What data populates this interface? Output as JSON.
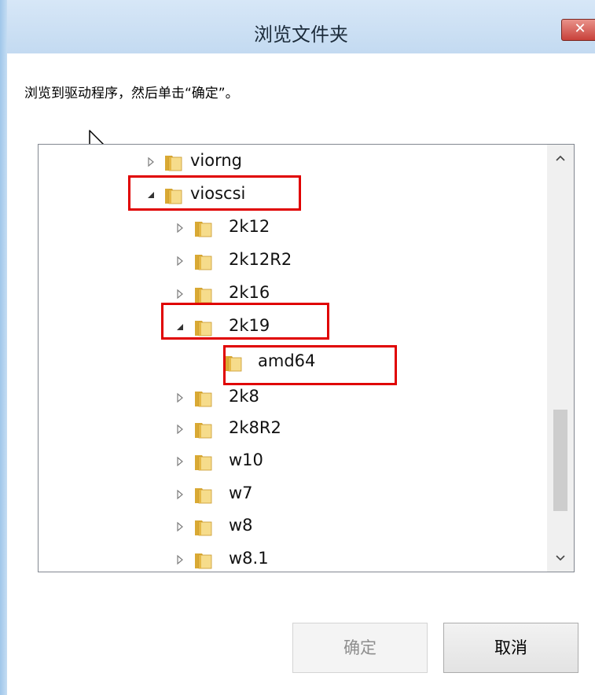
{
  "window": {
    "title": "浏览文件夹",
    "close_label": "✕"
  },
  "instruction": "浏览到驱动程序，然后单击“确定”。",
  "tree": {
    "items": [
      {
        "label": "viorng",
        "state": "collapsed"
      },
      {
        "label": "vioscsi",
        "state": "expanded",
        "highlighted": true
      },
      {
        "label": "2k12",
        "state": "collapsed"
      },
      {
        "label": "2k12R2",
        "state": "collapsed"
      },
      {
        "label": "2k16",
        "state": "collapsed"
      },
      {
        "label": "2k19",
        "state": "expanded",
        "highlighted": true
      },
      {
        "label": "amd64",
        "state": "leaf",
        "highlighted": true
      },
      {
        "label": "2k8",
        "state": "collapsed"
      },
      {
        "label": "2k8R2",
        "state": "collapsed"
      },
      {
        "label": "w10",
        "state": "collapsed"
      },
      {
        "label": "w7",
        "state": "collapsed"
      },
      {
        "label": "w8",
        "state": "collapsed"
      },
      {
        "label": "w8.1",
        "state": "collapsed"
      }
    ],
    "scroll_up_label": "^",
    "scroll_down_label": "v"
  },
  "buttons": {
    "ok_label": "确定",
    "cancel_label": "取消"
  },
  "colors": {
    "highlight": "#e00000",
    "titlebar": "#c9ddf2",
    "disabled_text": "#8e8e8e"
  },
  "icons": {
    "folder": "folder-icon",
    "collapsed": "triangle-right-icon",
    "expanded": "triangle-down-icon",
    "cursor": "mouse-pointer-icon"
  }
}
